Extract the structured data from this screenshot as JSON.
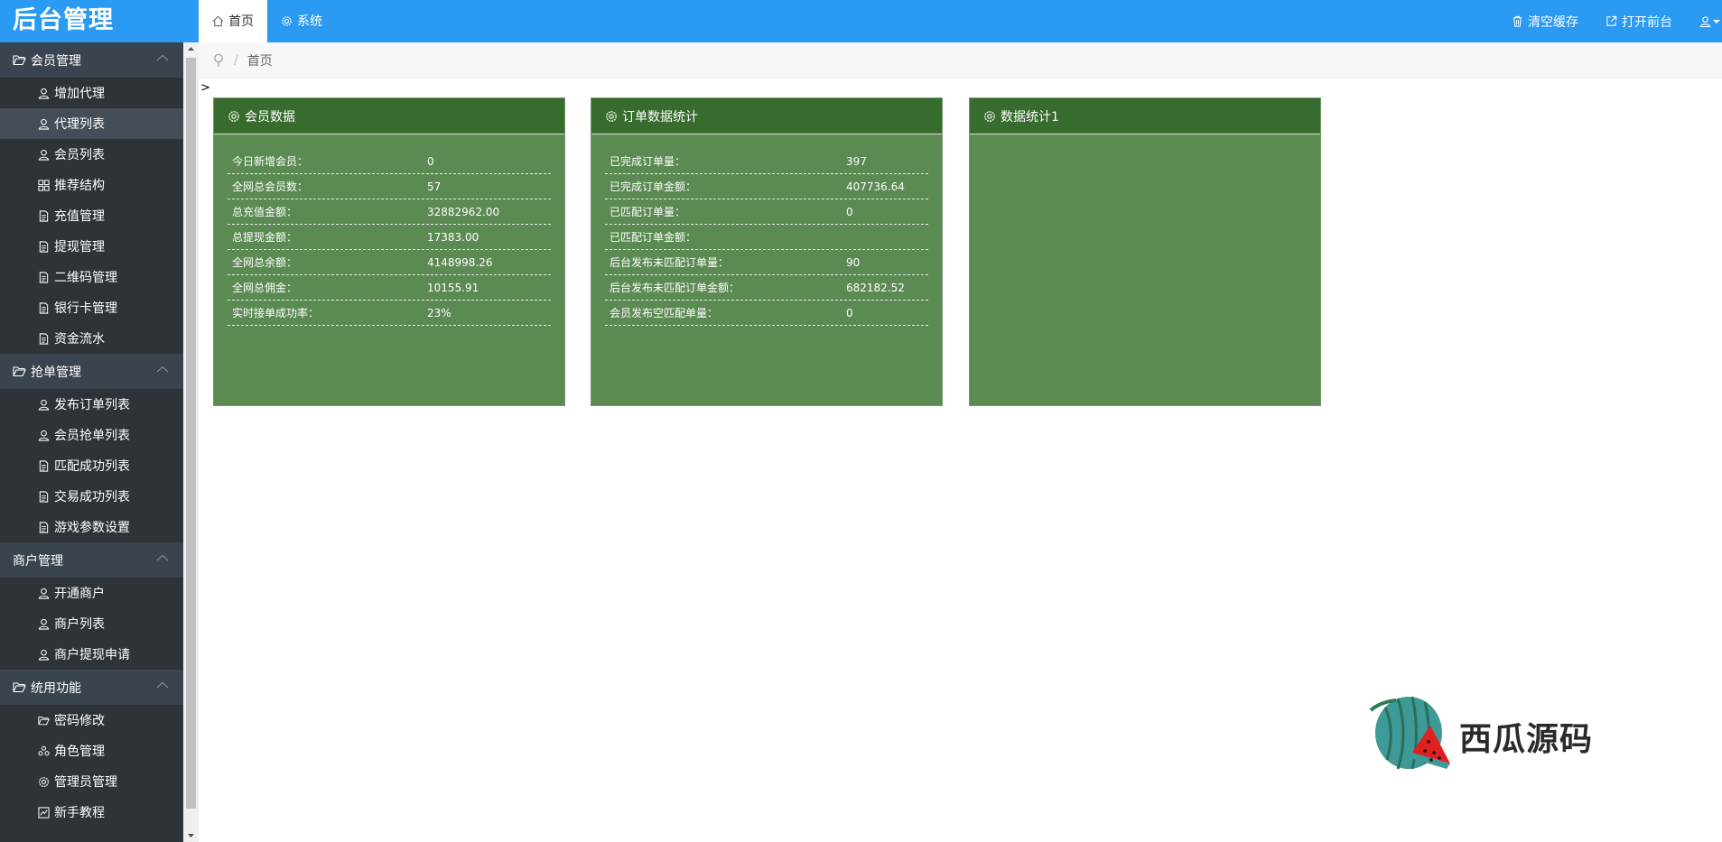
{
  "app": {
    "title": "后台管理"
  },
  "tabs": [
    {
      "label": "首页",
      "icon": "home-icon",
      "active": true
    },
    {
      "label": "系统",
      "icon": "gear-icon",
      "active": false
    }
  ],
  "top_actions": {
    "clear_cache": "清空缓存",
    "open_front": "打开前台"
  },
  "sidebar": {
    "groups": [
      {
        "label": "会员管理",
        "items": [
          {
            "label": "增加代理",
            "icon": "user-icon"
          },
          {
            "label": "代理列表",
            "icon": "user-icon",
            "highlighted": true
          },
          {
            "label": "会员列表",
            "icon": "user-icon"
          },
          {
            "label": "推荐结构",
            "icon": "grid-icon"
          },
          {
            "label": "充值管理",
            "icon": "document-icon"
          },
          {
            "label": "提现管理",
            "icon": "document-icon"
          },
          {
            "label": "二维码管理",
            "icon": "document-icon"
          },
          {
            "label": "银行卡管理",
            "icon": "document-icon"
          },
          {
            "label": "资金流水",
            "icon": "document-icon"
          }
        ]
      },
      {
        "label": "抢单管理",
        "items": [
          {
            "label": "发布订单列表",
            "icon": "user-icon"
          },
          {
            "label": "会员抢单列表",
            "icon": "user-icon"
          },
          {
            "label": "匹配成功列表",
            "icon": "document-icon"
          },
          {
            "label": "交易成功列表",
            "icon": "document-icon"
          },
          {
            "label": "游戏参数设置",
            "icon": "document-icon"
          }
        ]
      },
      {
        "label": "商户管理",
        "items": [
          {
            "label": "开通商户",
            "icon": "user-icon"
          },
          {
            "label": "商户列表",
            "icon": "user-icon"
          },
          {
            "label": "商户提现申请",
            "icon": "user-icon"
          }
        ]
      },
      {
        "label": "统用功能",
        "items": [
          {
            "label": "密码修改",
            "icon": "folder-icon"
          },
          {
            "label": "角色管理",
            "icon": "users-icon"
          },
          {
            "label": "管理员管理",
            "icon": "gear-icon"
          },
          {
            "label": "新手教程",
            "icon": "chart-icon"
          }
        ]
      }
    ]
  },
  "breadcrumb": {
    "current": "首页"
  },
  "stray_text": ">",
  "cards": [
    {
      "title": "会员数据",
      "rows": [
        {
          "label": "今日新增会员：",
          "value": "0"
        },
        {
          "label": "全网总会员数：",
          "value": "57"
        },
        {
          "label": "总充值金额：",
          "value": "32882962.00"
        },
        {
          "label": "总提现金额：",
          "value": "17383.00"
        },
        {
          "label": "全网总余额：",
          "value": "4148998.26"
        },
        {
          "label": "全网总佣金：",
          "value": "10155.91"
        },
        {
          "label": "实时接单成功率：",
          "value": "23%"
        }
      ]
    },
    {
      "title": "订单数据统计",
      "rows": [
        {
          "label": "已完成订单量：",
          "value": "397"
        },
        {
          "label": "已完成订单金额：",
          "value": "407736.64"
        },
        {
          "label": "已匹配订单量：",
          "value": "0"
        },
        {
          "label": "已匹配订单金额：",
          "value": ""
        },
        {
          "label": "后台发布未匹配订单量：",
          "value": "90"
        },
        {
          "label": "后台发布未匹配订单金额：",
          "value": "682182.52"
        },
        {
          "label": "会员发布空匹配单量：",
          "value": "0"
        }
      ]
    },
    {
      "title": "数据统计1",
      "rows": []
    }
  ],
  "watermark": {
    "text": "西瓜源码"
  },
  "colors": {
    "topbar": "#2b9af3",
    "sidebar": "#2e3338",
    "card": "#5b8a52",
    "card_head": "#386b2e"
  }
}
